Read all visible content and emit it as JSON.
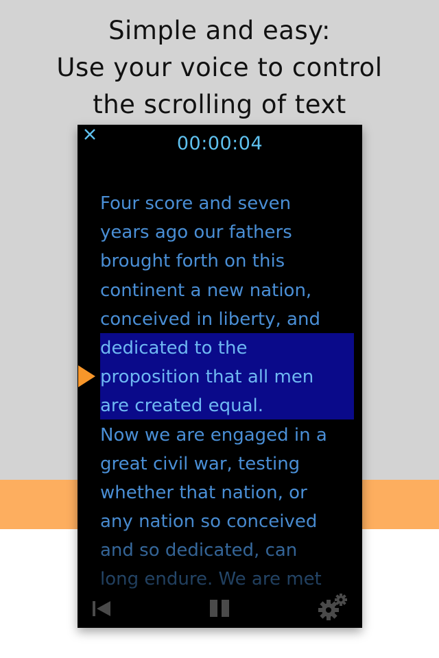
{
  "headline": {
    "lines": [
      "Simple and easy:",
      "Use your voice to control",
      "the scrolling of text"
    ]
  },
  "player": {
    "timer": "00:00:04",
    "close_icon": "close-icon",
    "script_lines": [
      "Four score and seven",
      "years ago our fathers",
      "brought forth on this",
      "continent a new nation,",
      "conceived in liberty, and",
      "dedicated to the",
      "proposition that all men",
      "are created equal.",
      "Now we are engaged in a",
      "great civil war, testing",
      "whether that nation, or",
      "any nation so conceived",
      "and so dedicated, can",
      "long endure. We are met"
    ],
    "toolbar": {
      "rewind_icon": "rewind-to-start-icon",
      "pause_icon": "pause-icon",
      "settings_icon": "settings-gears-icon"
    }
  },
  "colors": {
    "background_top": "#d3d3d3",
    "band": "#fdae5f",
    "timer": "#5fc1ef",
    "text": "#4a8fd6",
    "highlight": "#0a0a8a",
    "marker": "#f7962a",
    "controls": "#4a4a4a"
  }
}
